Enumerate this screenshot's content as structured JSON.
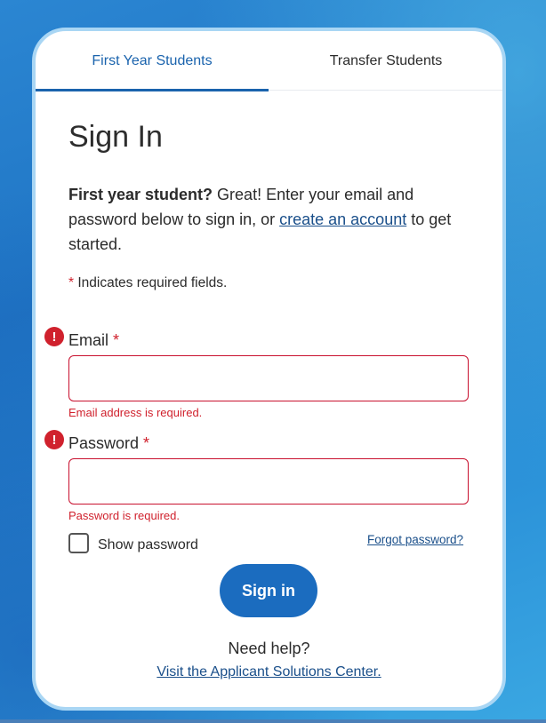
{
  "tabs": [
    {
      "label": "First Year Students",
      "active": true
    },
    {
      "label": "Transfer Students",
      "active": false
    }
  ],
  "page": {
    "title": "Sign In",
    "intro_bold": "First year student?",
    "intro_text1": " Great! Enter your email and password below to sign in, or ",
    "intro_link": "create an account",
    "intro_text2": " to get started.",
    "required_star": "*",
    "required_note": " Indicates required fields."
  },
  "form": {
    "email": {
      "label": "Email",
      "required_mark": "*",
      "value": "",
      "error": "Email address is required.",
      "error_icon": "alert-circle-icon"
    },
    "password": {
      "label": "Password",
      "required_mark": "*",
      "value": "",
      "error": "Password is required.",
      "error_icon": "alert-circle-icon"
    },
    "show_password_label": "Show password",
    "show_password_checked": false,
    "forgot_password": "Forgot password?",
    "submit_label": "Sign in"
  },
  "help": {
    "heading": "Need help?",
    "link": "Visit the Applicant Solutions Center."
  },
  "colors": {
    "accent": "#1b6cbf",
    "error": "#d0212d",
    "link": "#1a4f8a"
  }
}
